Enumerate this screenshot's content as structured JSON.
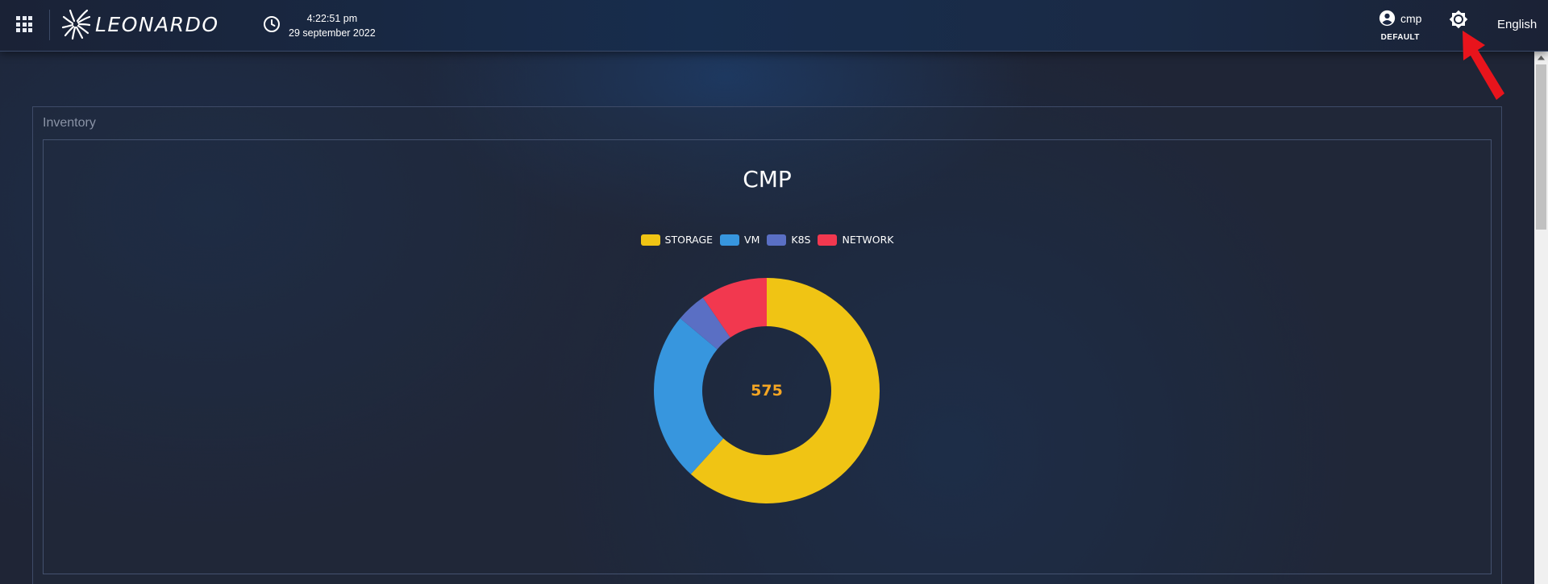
{
  "header": {
    "brand": "LEONARDO",
    "time": "4:22:51 pm",
    "date": "29 september 2022",
    "user": "cmp",
    "role": "DEFAULT",
    "language": "English",
    "icons": {
      "apps": "apps-grid-icon",
      "clock": "clock-icon",
      "user": "account-circle-icon",
      "settings": "settings-brightness-icon"
    }
  },
  "inventory": {
    "title": "Inventory"
  },
  "chart_data": {
    "type": "pie",
    "title": "CMP",
    "total_label": "575",
    "labels": [
      "STORAGE",
      "VM",
      "K8S",
      "NETWORK"
    ],
    "values": [
      355,
      140,
      25,
      55
    ],
    "colors": [
      "#f0c414",
      "#3796de",
      "#5a6fc4",
      "#f2384f"
    ],
    "legend_position": "top"
  },
  "annotation": {
    "color": "#e8141c",
    "points_to": "settings-button"
  }
}
